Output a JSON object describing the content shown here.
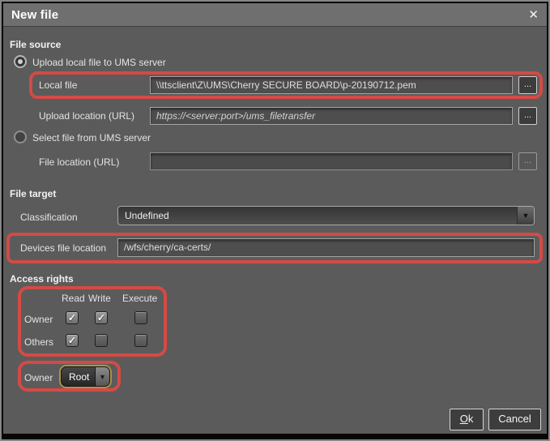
{
  "dialog": {
    "title": "New file"
  },
  "icons": {
    "close": "✕",
    "dropdown_arrow": "▼",
    "browse": "..."
  },
  "file_source": {
    "heading": "File source",
    "upload_radio_label": "Upload local file to UMS server",
    "upload_radio_selected": true,
    "local_file_label": "Local file",
    "local_file_value": "\\\\ttsclient\\Z\\UMS\\Cherry SECURE BOARD\\p-20190712.pem",
    "upload_location_label": "Upload location (URL)",
    "upload_location_value": "https://<server:port>/ums_filetransfer",
    "select_radio_label": "Select file from UMS server",
    "select_radio_selected": false,
    "file_location_label": "File location (URL)",
    "file_location_value": ""
  },
  "file_target": {
    "heading": "File target",
    "classification_label": "Classification",
    "classification_value": "Undefined",
    "devices_location_label": "Devices file location",
    "devices_location_value": "/wfs/cherry/ca-certs/"
  },
  "access_rights": {
    "heading": "Access rights",
    "columns": [
      "Read",
      "Write",
      "Execute"
    ],
    "rows": [
      {
        "label": "Owner",
        "read": "✓",
        "write": "✓",
        "execute": ""
      },
      {
        "label": "Others",
        "read": "✓",
        "write": "",
        "execute": ""
      }
    ],
    "owner_label": "Owner",
    "owner_value": "Root"
  },
  "footer": {
    "ok_mnemonic": "O",
    "ok_rest": "k",
    "cancel_label": "Cancel"
  },
  "colors": {
    "highlight": "#d54a45",
    "focus_ring": "#ab924c"
  }
}
